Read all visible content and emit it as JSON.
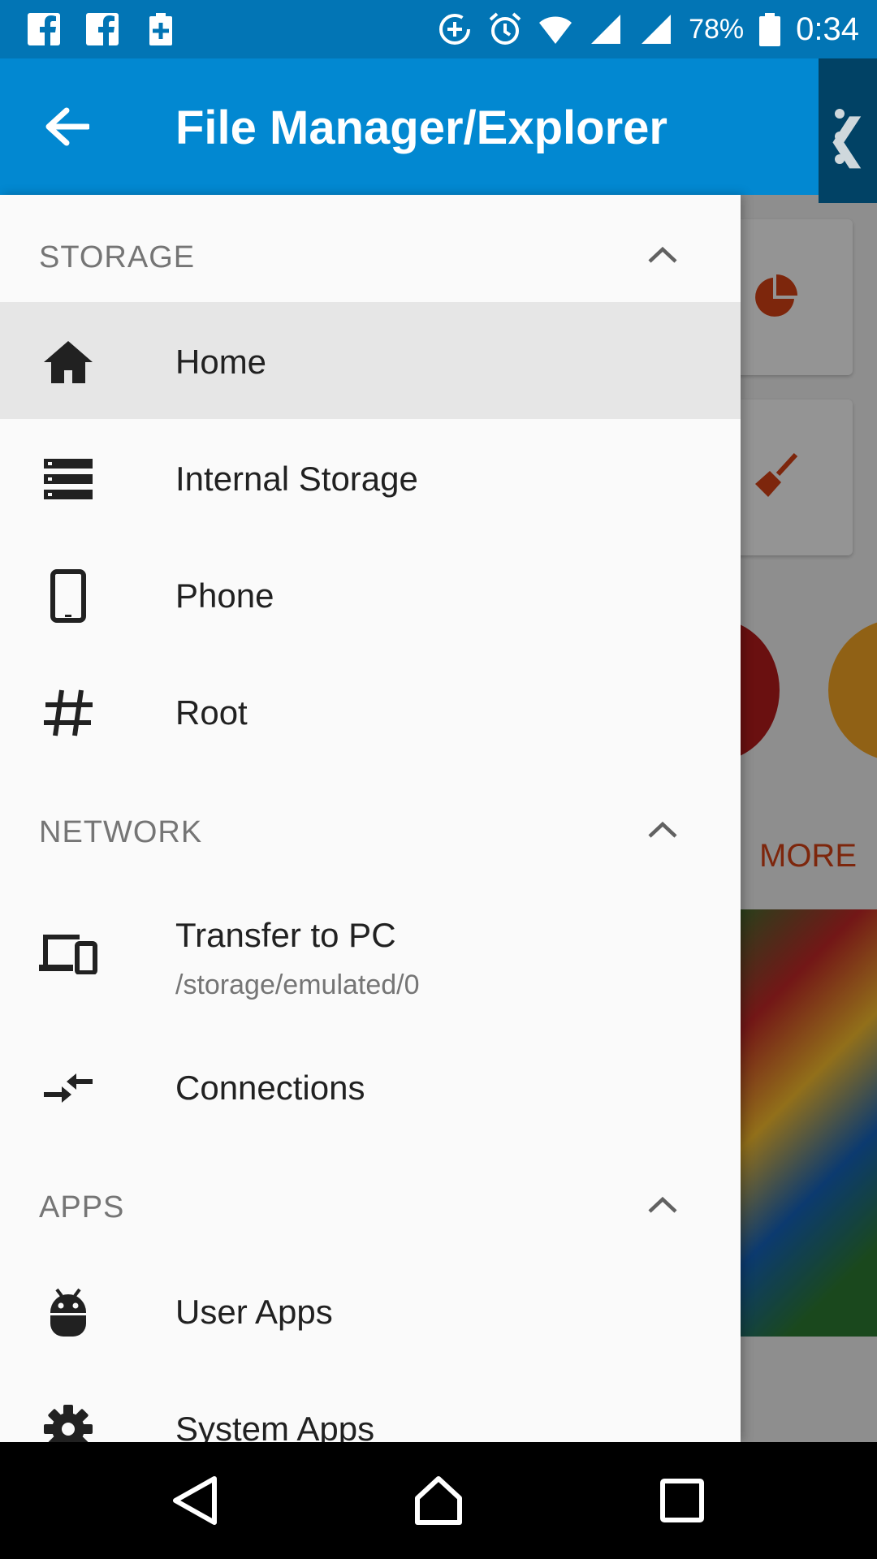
{
  "status_bar": {
    "battery_percent": "78%",
    "time": "0:34"
  },
  "app_bar": {
    "title": "File Manager/Explorer",
    "back_icon": "arrow-back-icon"
  },
  "background": {
    "more_label": "MORE"
  },
  "drawer": {
    "sections": {
      "storage": {
        "title": "STORAGE"
      },
      "network": {
        "title": "NETWORK"
      },
      "apps": {
        "title": "APPS"
      }
    },
    "storage_items": [
      {
        "label": "Home",
        "icon": "home-icon",
        "active": true
      },
      {
        "label": "Internal Storage",
        "icon": "storage-icon"
      },
      {
        "label": "Phone",
        "icon": "phone-icon"
      },
      {
        "label": "Root",
        "icon": "hash-icon"
      }
    ],
    "network_items": [
      {
        "label": "Transfer to PC",
        "sublabel": "/storage/emulated/0",
        "icon": "devices-icon"
      },
      {
        "label": "Connections",
        "icon": "compare-arrows-icon"
      }
    ],
    "apps_items": [
      {
        "label": "User Apps",
        "icon": "android-icon"
      },
      {
        "label": "System Apps",
        "icon": "settings-gear-icon"
      }
    ]
  },
  "colors": {
    "status_bar": "#0275b5",
    "app_bar": "#0288d1",
    "drawer_bg": "#fafafa",
    "active_item_bg": "#e6e6e6",
    "section_title": "#757575",
    "accent_more": "#d84315"
  }
}
